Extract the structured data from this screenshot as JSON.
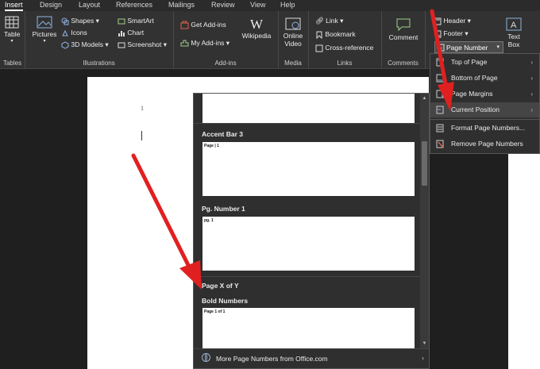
{
  "tabs": [
    "Insert",
    "Design",
    "Layout",
    "References",
    "Mailings",
    "Review",
    "View",
    "Help"
  ],
  "ribbon": {
    "tables": {
      "table": "Table",
      "group": "Tables"
    },
    "illustrations": {
      "pictures": "Pictures",
      "shapes": "Shapes",
      "icons": "Icons",
      "models": "3D Models",
      "smartart": "SmartArt",
      "chart": "Chart",
      "screenshot": "Screenshot",
      "group": "Illustrations"
    },
    "addins": {
      "get": "Get Add-ins",
      "my": "My Add-ins",
      "wikipedia": "Wikipedia",
      "group": "Add-ins"
    },
    "media": {
      "online_video_1": "Online",
      "online_video_2": "Video",
      "group": "Media"
    },
    "links": {
      "link": "Link",
      "bookmark": "Bookmark",
      "crossref": "Cross-reference",
      "group": "Links"
    },
    "comments": {
      "comment": "Comment",
      "group": "Comments"
    },
    "header_footer": {
      "header": "Header",
      "footer": "Footer",
      "page_number": "Page Number"
    },
    "text": {
      "textbox_1": "Text",
      "textbox_2": "Box"
    }
  },
  "document": {
    "page_number": "1"
  },
  "gallery": {
    "items": [
      {
        "title": "Accent Bar 3",
        "preview": "Page | 1"
      },
      {
        "title": "Pg. Number 1",
        "preview": "pg. 1"
      }
    ],
    "section": "Page X of Y",
    "section_item": {
      "title": "Bold Numbers",
      "preview": "Page 1 of 1"
    },
    "more": "More Page Numbers from Office.com"
  },
  "menu": {
    "items": [
      "Top of Page",
      "Bottom of Page",
      "Page Margins",
      "Current Position"
    ],
    "format": "Format Page Numbers...",
    "remove": "Remove Page Numbers"
  }
}
